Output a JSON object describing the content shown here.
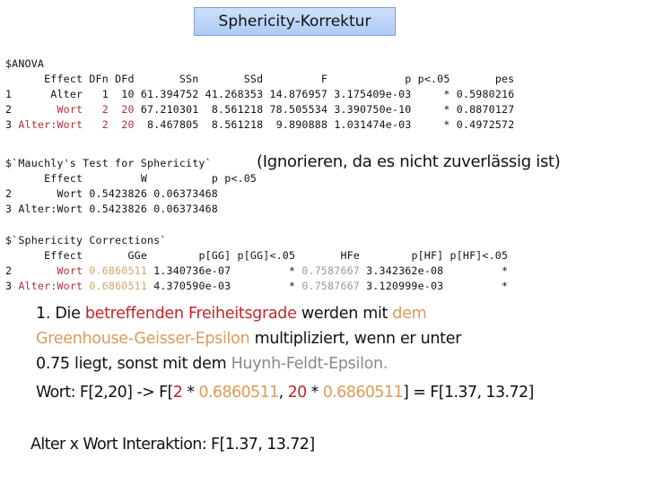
{
  "title": "Sphericity-Korrektur",
  "anova": {
    "label": "$ANOVA",
    "headers": [
      "Effect",
      "DFn",
      "DFd",
      "SSn",
      "SSd",
      "F",
      "p",
      "p<.05",
      "pes"
    ],
    "rows": [
      {
        "idx": "1",
        "effect": "Alter",
        "dfn": "1",
        "dfd": "10",
        "ssn": "61.394752",
        "ssd": "41.268353",
        "f": "14.876957",
        "p": "3.175409e-03",
        "sig": "*",
        "pes": "0.5980216"
      },
      {
        "idx": "2",
        "effect": "Wort",
        "dfn": "2",
        "dfd": "20",
        "ssn": "67.210301",
        "ssd": "8.561218",
        "f": "78.505534",
        "p": "3.390750e-10",
        "sig": "*",
        "pes": "0.8870127"
      },
      {
        "idx": "3",
        "effect": "Alter:Wort",
        "dfn": "2",
        "dfd": "20",
        "ssn": "8.467805",
        "ssd": "8.561218",
        "f": "9.890888",
        "p": "1.031474e-03",
        "sig": "*",
        "pes": "0.4972572"
      }
    ]
  },
  "mauchly": {
    "label": "$`Mauchly's Test for Sphericity`",
    "note": "(Ignorieren, da es nicht zuverlässig ist)",
    "headers": [
      "Effect",
      "W",
      "p",
      "p<.05"
    ],
    "rows": [
      {
        "idx": "2",
        "effect": "Wort",
        "w": "0.5423826",
        "p": "0.06373468",
        "sig": ""
      },
      {
        "idx": "3",
        "effect": "Alter:Wort",
        "w": "0.5423826",
        "p": "0.06373468",
        "sig": ""
      }
    ]
  },
  "corrections": {
    "label": "$`Sphericity Corrections`",
    "headers": [
      "Effect",
      "GGe",
      "p[GG]",
      "p[GG]<.05",
      "HFe",
      "p[HF]",
      "p[HF]<.05"
    ],
    "rows": [
      {
        "idx": "2",
        "effect": "Wort",
        "gge": "0.6860511",
        "pgg": "1.340736e-07",
        "gg_sig": "*",
        "hfe": "0.7587667",
        "phf": "3.342362e-08",
        "hf_sig": "*"
      },
      {
        "idx": "3",
        "effect": "Alter:Wort",
        "gge": "0.6860511",
        "pgg": "4.370590e-03",
        "gg_sig": "*",
        "hfe": "0.7587667",
        "phf": "3.120999e-03",
        "hf_sig": "*"
      }
    ]
  },
  "explanation": {
    "part1": "1. Die ",
    "red": "betreffenden Freiheitsgrade",
    "part2": " werden mit ",
    "gold1": "dem",
    "gold2": "Greenhouse-Geisser-Epsilon",
    "part3": " multipliziert, wenn er unter",
    "part4": "0.75 liegt, sonst mit dem ",
    "grey": "Huynh-Feldt-Epsilon."
  },
  "formula": {
    "prefix": "Wort: F[2,20] -> F[",
    "df1": "2",
    "times1": " * ",
    "eps1": "0.6860511",
    "comma": ", ",
    "df2": "20",
    "times2": " * ",
    "eps2": "0.6860511",
    "suffix": "] = F[1.37,   13.72]"
  },
  "interaction": "Alter x Wort Interaktion: F[1.37, 13.72]",
  "colors": {
    "title_bg": "#bcd4f8",
    "highlight_red": "#c0262d",
    "highlight_gold": "#dc9a5a",
    "highlight_grey": "#8a8a8a"
  }
}
